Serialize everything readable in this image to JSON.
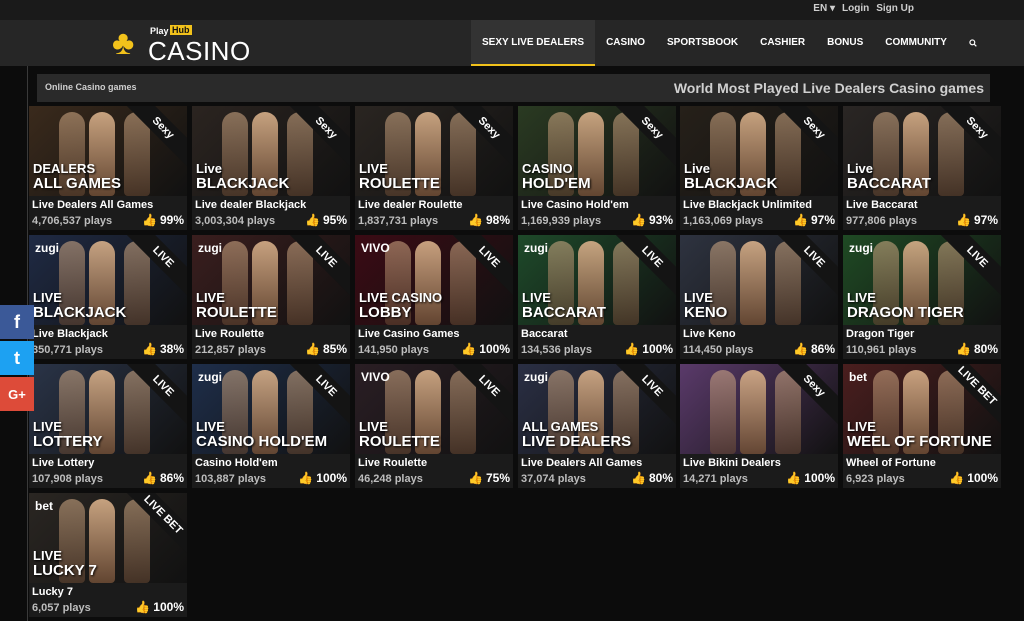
{
  "topbar": {
    "lang": "EN",
    "login": "Login",
    "signup": "Sign Up"
  },
  "logo": {
    "line1": "Play",
    "line2": "Hub",
    "word": "CASINO"
  },
  "nav": [
    "SEXY LIVE DEALERS",
    "CASINO",
    "SPORTSBOOK",
    "CASHIER",
    "BONUS",
    "COMMUNITY"
  ],
  "subheader": {
    "left": "Online Casino games",
    "right": "World Most Played Live Dealers Casino games"
  },
  "colors": {
    "accent": "#f2c21b",
    "thumb": "#6cbf2f",
    "facebook": "#3b5998",
    "twitter": "#1da1f2",
    "google": "#dd4b39"
  },
  "social": [
    "f",
    "t",
    "G+"
  ],
  "games": [
    {
      "name": "Live Dealers All Games",
      "plays": "4,706,537 plays",
      "pct": "99%",
      "badge": "Sexy",
      "cap1": "DEALERS",
      "cap2": "ALL GAMES",
      "brand": "",
      "bg": "#3a2a1c"
    },
    {
      "name": "Live dealer Blackjack",
      "plays": "3,003,304 plays",
      "pct": "95%",
      "badge": "Sexy",
      "cap1": "Live",
      "cap2": "BLACKJACK",
      "brand": "",
      "bg": "#2b2420"
    },
    {
      "name": "Live dealer Roulette",
      "plays": "1,837,731 plays",
      "pct": "98%",
      "badge": "Sexy",
      "cap1": "LIVE",
      "cap2": "ROULETTE",
      "brand": "",
      "bg": "#2a2521"
    },
    {
      "name": "Live Casino Hold'em",
      "plays": "1,169,939 plays",
      "pct": "93%",
      "badge": "Sexy",
      "cap1": "CASINO",
      "cap2": "HOLD'EM",
      "brand": "",
      "bg": "#2a3a22"
    },
    {
      "name": "Live Blackjack Unlimited",
      "plays": "1,163,069 plays",
      "pct": "97%",
      "badge": "Sexy",
      "cap1": "Live",
      "cap2": "BLACKJACK",
      "brand": "",
      "bg": "#262019"
    },
    {
      "name": "Live Baccarat",
      "plays": "977,806 plays",
      "pct": "97%",
      "badge": "Sexy",
      "cap1": "Live",
      "cap2": "BACCARAT",
      "brand": "",
      "bg": "#2a2624"
    },
    {
      "name": "Live Blackjack",
      "plays": "350,771 plays",
      "pct": "38%",
      "badge": "LIVE",
      "cap1": "LIVE",
      "cap2": "BLACKJACK",
      "brand": "zugi",
      "bg": "#1f2a44"
    },
    {
      "name": "Live Roulette",
      "plays": "212,857 plays",
      "pct": "85%",
      "badge": "LIVE",
      "cap1": "LIVE",
      "cap2": "ROULETTE",
      "brand": "zugi",
      "bg": "#3a1e1e"
    },
    {
      "name": "Live Casino Games",
      "plays": "141,950 plays",
      "pct": "100%",
      "badge": "LIVE",
      "cap1": "LIVE CASINO",
      "cap2": "LOBBY",
      "brand": "VIVO",
      "bg": "#3b0b14"
    },
    {
      "name": "Baccarat",
      "plays": "134,536 plays",
      "pct": "100%",
      "badge": "LIVE",
      "cap1": "LIVE",
      "cap2": "BACCARAT",
      "brand": "zugi",
      "bg": "#1e4a2a"
    },
    {
      "name": "Live Keno",
      "plays": "114,450 plays",
      "pct": "86%",
      "badge": "LIVE",
      "cap1": "LIVE",
      "cap2": "KENO",
      "brand": "",
      "bg": "#2e3340"
    },
    {
      "name": "Dragon Tiger",
      "plays": "110,961 plays",
      "pct": "80%",
      "badge": "LIVE",
      "cap1": "LIVE",
      "cap2": "DRAGON TIGER",
      "brand": "zugi",
      "bg": "#1f4a24"
    },
    {
      "name": "Live Lottery",
      "plays": "107,908 plays",
      "pct": "86%",
      "badge": "LIVE",
      "cap1": "LIVE",
      "cap2": "LOTTERY",
      "brand": "",
      "bg": "#2a3448"
    },
    {
      "name": "Casino Hold'em",
      "plays": "103,887 plays",
      "pct": "100%",
      "badge": "LIVE",
      "cap1": "LIVE",
      "cap2": "CASINO HOLD'EM",
      "brand": "zugi",
      "bg": "#1e2e4a"
    },
    {
      "name": "Live Roulette",
      "plays": "46,248 plays",
      "pct": "75%",
      "badge": "LIVE",
      "cap1": "LIVE",
      "cap2": "ROULETTE",
      "brand": "VIVO",
      "bg": "#2a1e24"
    },
    {
      "name": "Live Dealers All Games",
      "plays": "37,074 plays",
      "pct": "80%",
      "badge": "LIVE",
      "cap1": "ALL GAMES",
      "cap2": "LIVE DEALERS",
      "brand": "zugi",
      "bg": "#2a2f44"
    },
    {
      "name": "Live Bikini Dealers",
      "plays": "14,271 plays",
      "pct": "100%",
      "badge": "Sexy",
      "cap1": "",
      "cap2": "",
      "brand": "",
      "bg": "#5a3a6a"
    },
    {
      "name": "Wheel of Fortune",
      "plays": "6,923 plays",
      "pct": "100%",
      "badge": "LIVE BET",
      "cap1": "LIVE",
      "cap2": "WEEL OF FORTUNE",
      "brand": "bet",
      "bg": "#4a1e1e"
    },
    {
      "name": "Lucky 7",
      "plays": "6,057 plays",
      "pct": "100%",
      "badge": "LIVE BET",
      "cap1": "LIVE",
      "cap2": "LUCKY 7",
      "brand": "bet",
      "bg": "#2a2622"
    }
  ]
}
